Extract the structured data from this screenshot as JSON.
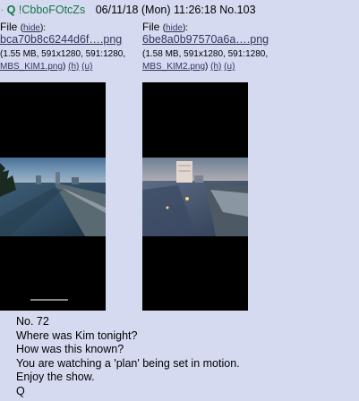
{
  "header": {
    "dash": "·",
    "name": "Q",
    "tripcode": "!CbboFOtcZs",
    "datetime": "06/11/18 (Mon) 11:26:18",
    "post_no": "No.103"
  },
  "files": [
    {
      "label": "File",
      "hide": "hide",
      "filename": "bca70b8c6244d6f….png",
      "meta_size": "(1.55 MB, 591x1280, 591:1280,",
      "original_name": "MBS_KIM1.png",
      "h": "(h)",
      "u": "(u)"
    },
    {
      "label": "File",
      "hide": "hide",
      "filename": "6be8a0b97570a6a….png",
      "meta_size": "(1.58 MB, 591x1280, 591:1280,",
      "original_name": "MBS_KIM2.png",
      "h": "(h)",
      "u": "(u)"
    }
  ],
  "body": {
    "lines": [
      "No. 72",
      "Where was Kim tonight?",
      "How was this known?",
      "You are watching a 'plan' being set in motion.",
      "Enjoy the show.",
      "Q"
    ]
  },
  "colors": {
    "background": "#d6daf0",
    "name": "#117743",
    "link": "#34345c"
  }
}
